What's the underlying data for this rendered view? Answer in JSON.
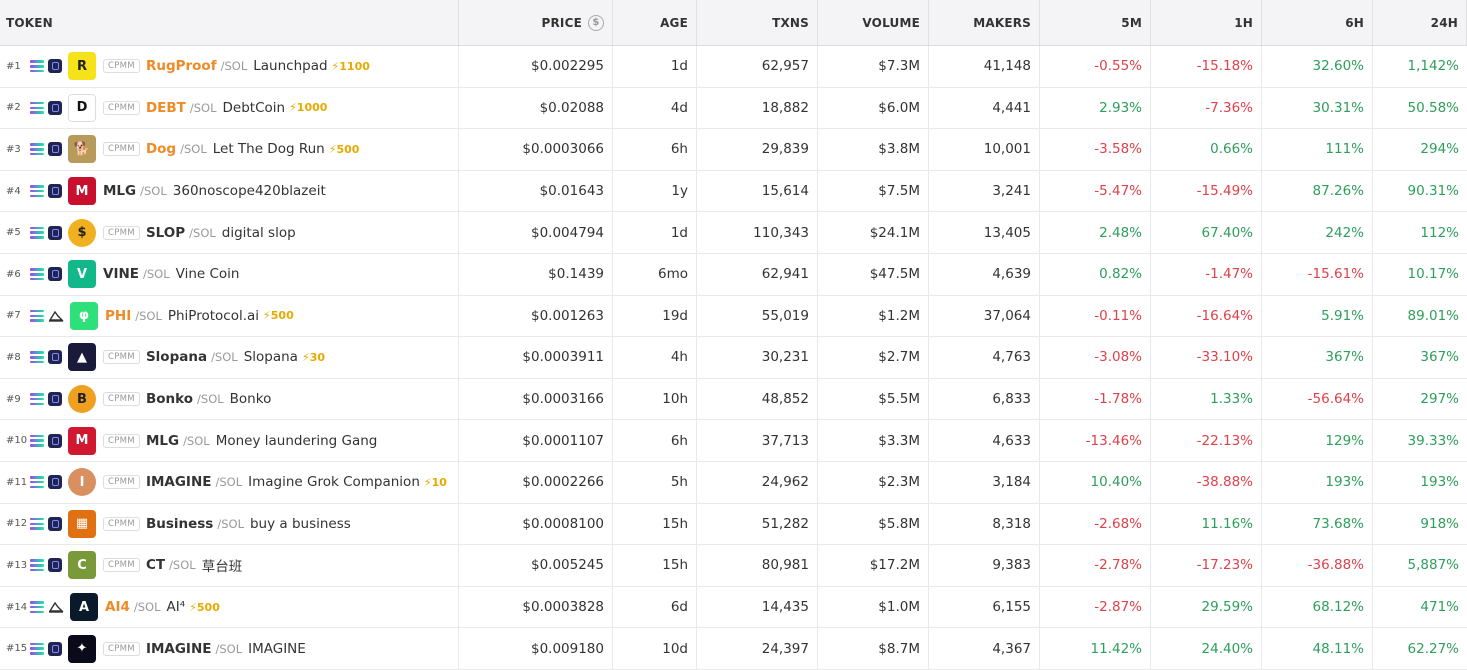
{
  "headers": {
    "token": "TOKEN",
    "price": "PRICE",
    "age": "AGE",
    "txns": "TXNS",
    "volume": "VOLUME",
    "makers": "MAKERS",
    "m5": "5M",
    "h1": "1H",
    "h6": "6H",
    "h24": "24H"
  },
  "price_header_icon": "dollar-circle-icon",
  "rows": [
    {
      "rank": "#1",
      "dex_icon": "raydium-icon",
      "tag": "CPMM",
      "symbol": "RugProof",
      "symbol_orange": true,
      "pair": "/SOL",
      "name": "Launchpad",
      "boost": "⚡1100",
      "avatar_color": "#f5e21a",
      "avatar_glyph": "R",
      "price": "$0.002295",
      "age": "1d",
      "txns": "62,957",
      "volume": "$7.3M",
      "makers": "41,148",
      "m5": "-0.55%",
      "h1": "-15.18%",
      "h6": "32.60%",
      "h24": "1,142%"
    },
    {
      "rank": "#2",
      "dex_icon": "raydium-icon",
      "tag": "CPMM",
      "symbol": "DEBT",
      "symbol_orange": true,
      "pair": "/SOL",
      "name": "DebtCoin",
      "boost": "⚡1000",
      "avatar_color": "#ffffff",
      "avatar_glyph": "D",
      "price": "$0.02088",
      "age": "4d",
      "txns": "18,882",
      "volume": "$6.0M",
      "makers": "4,441",
      "m5": "2.93%",
      "h1": "-7.36%",
      "h6": "30.31%",
      "h24": "50.58%"
    },
    {
      "rank": "#3",
      "dex_icon": "raydium-icon",
      "tag": "CPMM",
      "symbol": "Dog",
      "symbol_orange": true,
      "pair": "/SOL",
      "name": "Let The Dog Run",
      "boost": "⚡500",
      "avatar_color": "#b89a5a",
      "avatar_glyph": "🐕",
      "price": "$0.0003066",
      "age": "6h",
      "txns": "29,839",
      "volume": "$3.8M",
      "makers": "10,001",
      "m5": "-3.58%",
      "h1": "0.66%",
      "h6": "111%",
      "h24": "294%"
    },
    {
      "rank": "#4",
      "dex_icon": "raydium-icon",
      "tag": "",
      "symbol": "MLG",
      "symbol_orange": false,
      "pair": "/SOL",
      "name": "360noscope420blazeit",
      "boost": "",
      "avatar_color": "#c8102e",
      "avatar_glyph": "M",
      "price": "$0.01643",
      "age": "1y",
      "txns": "15,614",
      "volume": "$7.5M",
      "makers": "3,241",
      "m5": "-5.47%",
      "h1": "-15.49%",
      "h6": "87.26%",
      "h24": "90.31%"
    },
    {
      "rank": "#5",
      "dex_icon": "raydium-icon",
      "tag": "CPMM",
      "symbol": "SLOP",
      "symbol_orange": false,
      "pair": "/SOL",
      "name": "digital slop",
      "boost": "",
      "avatar_color": "#f0b020",
      "avatar_glyph": "$",
      "price": "$0.004794",
      "age": "1d",
      "txns": "110,343",
      "volume": "$24.1M",
      "makers": "13,405",
      "m5": "2.48%",
      "h1": "67.40%",
      "h6": "242%",
      "h24": "112%"
    },
    {
      "rank": "#6",
      "dex_icon": "raydium-icon",
      "tag": "",
      "symbol": "VINE",
      "symbol_orange": false,
      "pair": "/SOL",
      "name": "Vine Coin",
      "boost": "",
      "avatar_color": "#12b88a",
      "avatar_glyph": "V",
      "price": "$0.1439",
      "age": "6mo",
      "txns": "62,941",
      "volume": "$47.5M",
      "makers": "4,639",
      "m5": "0.82%",
      "h1": "-1.47%",
      "h6": "-15.61%",
      "h24": "10.17%"
    },
    {
      "rank": "#7",
      "dex_icon": "pump-icon",
      "tag": "",
      "symbol": "PHI",
      "symbol_orange": true,
      "pair": "/SOL",
      "name": "PhiProtocol.ai",
      "boost": "⚡500",
      "avatar_color": "#2ee07a",
      "avatar_glyph": "φ",
      "price": "$0.001263",
      "age": "19d",
      "txns": "55,019",
      "volume": "$1.2M",
      "makers": "37,064",
      "m5": "-0.11%",
      "h1": "-16.64%",
      "h6": "5.91%",
      "h24": "89.01%"
    },
    {
      "rank": "#8",
      "dex_icon": "raydium-icon",
      "tag": "CPMM",
      "symbol": "Slopana",
      "symbol_orange": false,
      "pair": "/SOL",
      "name": "Slopana",
      "boost": "⚡30",
      "avatar_color": "#1a1a3a",
      "avatar_glyph": "▲",
      "price": "$0.0003911",
      "age": "4h",
      "txns": "30,231",
      "volume": "$2.7M",
      "makers": "4,763",
      "m5": "-3.08%",
      "h1": "-33.10%",
      "h6": "367%",
      "h24": "367%"
    },
    {
      "rank": "#9",
      "dex_icon": "raydium-icon",
      "tag": "CPMM",
      "symbol": "Bonko",
      "symbol_orange": false,
      "pair": "/SOL",
      "name": "Bonko",
      "boost": "",
      "avatar_color": "#f0a020",
      "avatar_glyph": "B",
      "price": "$0.0003166",
      "age": "10h",
      "txns": "48,852",
      "volume": "$5.5M",
      "makers": "6,833",
      "m5": "-1.78%",
      "h1": "1.33%",
      "h6": "-56.64%",
      "h24": "297%"
    },
    {
      "rank": "#10",
      "dex_icon": "raydium-icon",
      "tag": "CPMM",
      "symbol": "MLG",
      "symbol_orange": false,
      "pair": "/SOL",
      "name": "Money laundering Gang",
      "boost": "",
      "avatar_color": "#d01830",
      "avatar_glyph": "M",
      "price": "$0.0001107",
      "age": "6h",
      "txns": "37,713",
      "volume": "$3.3M",
      "makers": "4,633",
      "m5": "-13.46%",
      "h1": "-22.13%",
      "h6": "129%",
      "h24": "39.33%"
    },
    {
      "rank": "#11",
      "dex_icon": "raydium-icon",
      "tag": "CPMM",
      "symbol": "IMAGINE",
      "symbol_orange": false,
      "pair": "/SOL",
      "name": "Imagine Grok Companion",
      "boost": "⚡10",
      "avatar_color": "#d89060",
      "avatar_glyph": "I",
      "price": "$0.0002266",
      "age": "5h",
      "txns": "24,962",
      "volume": "$2.3M",
      "makers": "3,184",
      "m5": "10.40%",
      "h1": "-38.88%",
      "h6": "193%",
      "h24": "193%"
    },
    {
      "rank": "#12",
      "dex_icon": "raydium-icon",
      "tag": "CPMM",
      "symbol": "Business",
      "symbol_orange": false,
      "pair": "/SOL",
      "name": "buy a business",
      "boost": "",
      "avatar_color": "#e07010",
      "avatar_glyph": "▦",
      "price": "$0.0008100",
      "age": "15h",
      "txns": "51,282",
      "volume": "$5.8M",
      "makers": "8,318",
      "m5": "-2.68%",
      "h1": "11.16%",
      "h6": "73.68%",
      "h24": "918%"
    },
    {
      "rank": "#13",
      "dex_icon": "raydium-icon",
      "tag": "CPMM",
      "symbol": "CT",
      "symbol_orange": false,
      "pair": "/SOL",
      "name": "草台班",
      "boost": "",
      "avatar_color": "#7a9a3a",
      "avatar_glyph": "C",
      "price": "$0.005245",
      "age": "15h",
      "txns": "80,981",
      "volume": "$17.2M",
      "makers": "9,383",
      "m5": "-2.78%",
      "h1": "-17.23%",
      "h6": "-36.88%",
      "h24": "5,887%"
    },
    {
      "rank": "#14",
      "dex_icon": "pump-icon",
      "tag": "",
      "symbol": "AI4",
      "symbol_orange": true,
      "pair": "/SOL",
      "name": "AI⁴",
      "boost": "⚡500",
      "avatar_color": "#0a1a2a",
      "avatar_glyph": "A",
      "price": "$0.0003828",
      "age": "6d",
      "txns": "14,435",
      "volume": "$1.0M",
      "makers": "6,155",
      "m5": "-2.87%",
      "h1": "29.59%",
      "h6": "68.12%",
      "h24": "471%"
    },
    {
      "rank": "#15",
      "dex_icon": "raydium-icon",
      "tag": "CPMM",
      "symbol": "IMAGINE",
      "symbol_orange": false,
      "pair": "/SOL",
      "name": "IMAGINE",
      "boost": "",
      "avatar_color": "#0a0a1a",
      "avatar_glyph": "✦",
      "price": "$0.009180",
      "age": "10d",
      "txns": "24,397",
      "volume": "$8.7M",
      "makers": "4,367",
      "m5": "11.42%",
      "h1": "24.40%",
      "h6": "48.11%",
      "h24": "62.27%"
    }
  ],
  "colors": {
    "positive": "#2e9e5b",
    "negative": "#e0414a",
    "symbol_highlight": "#f08a24",
    "boost": "#e8a900",
    "header_bg": "#f4f4f6"
  }
}
